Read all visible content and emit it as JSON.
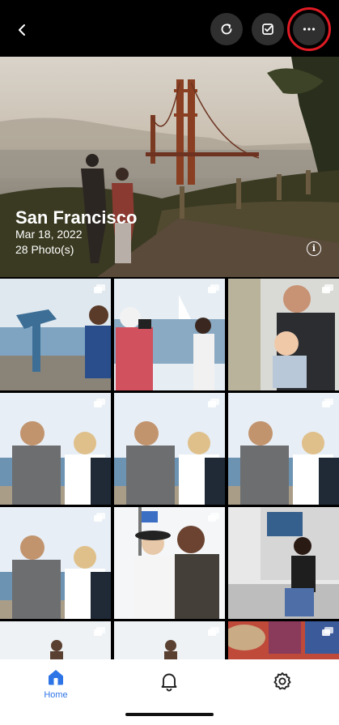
{
  "header": {
    "back_icon": "chevron-left-icon",
    "actions": [
      {
        "icon": "refresh-icon"
      },
      {
        "icon": "select-check-icon"
      },
      {
        "icon": "more-horizontal-icon",
        "highlighted": true
      }
    ],
    "highlight_color": "#e01b24"
  },
  "album": {
    "title": "San Francisco",
    "date": "Mar 18, 2022",
    "count": "28 Photo(s)",
    "info_glyph": "i"
  },
  "photos": [
    {
      "scene": "binoculars-pier",
      "stack": true
    },
    {
      "scene": "photographer-bay",
      "stack": true
    },
    {
      "scene": "man-with-baby",
      "stack": true
    },
    {
      "scene": "couple-kiss",
      "stack": true
    },
    {
      "scene": "couple-kiss",
      "stack": true
    },
    {
      "scene": "couple-kiss",
      "stack": true
    },
    {
      "scene": "couple-kiss",
      "stack": true
    },
    {
      "scene": "friends-selfie",
      "stack": true
    },
    {
      "scene": "man-photographing",
      "stack": false
    },
    {
      "scene": "statue-sky",
      "stack": true
    },
    {
      "scene": "statue-sky",
      "stack": true
    },
    {
      "scene": "crowd-hats",
      "stack": true
    }
  ],
  "nav": {
    "home_label": "Home",
    "active_color": "#2d74e6",
    "items": [
      {
        "icon": "home-icon",
        "label": "Home",
        "active": true
      },
      {
        "icon": "bell-icon"
      },
      {
        "icon": "gear-icon"
      }
    ]
  }
}
